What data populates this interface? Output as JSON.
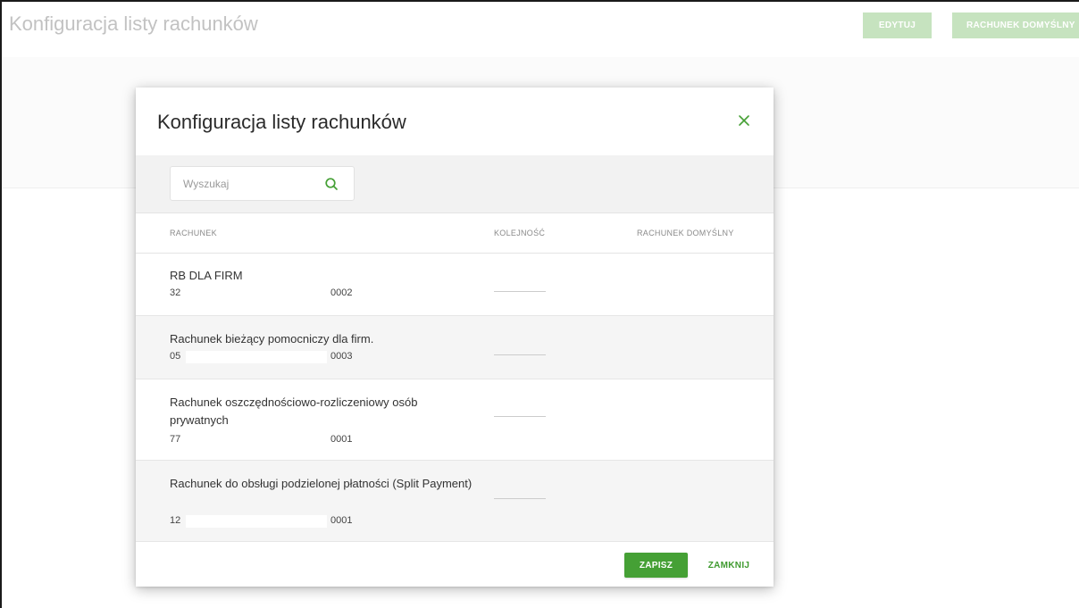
{
  "background": {
    "title": "Konfiguracja listy rachunków",
    "edit_button": "EDYTUJ",
    "default_account_button": "RACHUNEK DOMYŚLNY"
  },
  "modal": {
    "title": "Konfiguracja listy rachunków",
    "close_icon": "close-icon",
    "search": {
      "placeholder": "Wyszukaj",
      "value": "",
      "icon": "search-icon"
    },
    "columns": {
      "account": "RACHUNEK",
      "order": "KOLEJNOŚĆ",
      "default_account": "RACHUNEK DOMYŚLNY"
    },
    "accounts": [
      {
        "name": "RB DLA FIRM",
        "number_prefix": "32",
        "number_suffix": "0002",
        "order": ""
      },
      {
        "name": "Rachunek bieżący pomocniczy dla firm.",
        "number_prefix": "05",
        "number_suffix": "0003",
        "order": ""
      },
      {
        "name": "Rachunek oszczędnościowo-rozliczeniowy osób prywatnych",
        "number_prefix": "77",
        "number_suffix": "0001",
        "order": ""
      },
      {
        "name": "Rachunek do obsługi podzielonej płatności (Split Payment)",
        "number_prefix": "12",
        "number_suffix": "0001",
        "order": ""
      }
    ],
    "footer": {
      "save_label": "ZAPISZ",
      "close_label": "ZAMKNIJ"
    }
  },
  "colors": {
    "primary_green": "#45a035",
    "link_green": "#3f9a2f",
    "disabled_green": "#c6e3bf"
  }
}
